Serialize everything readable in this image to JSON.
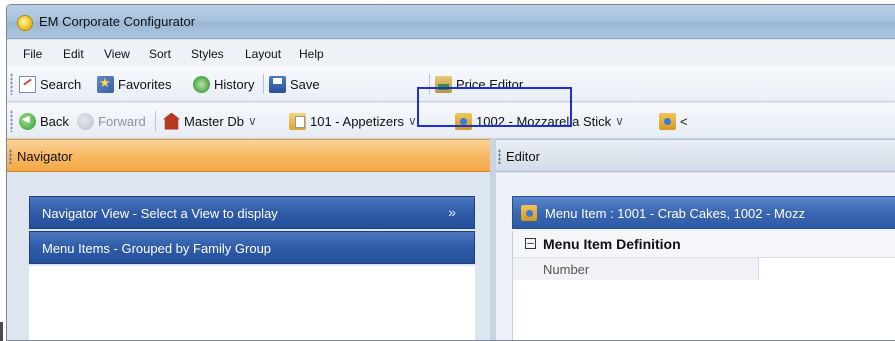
{
  "window": {
    "title": "EM Corporate Configurator"
  },
  "menu": [
    "File",
    "Edit",
    "View",
    "Sort",
    "Styles",
    "Layout",
    "Help"
  ],
  "toolbar": {
    "search": "Search",
    "favorites": "Favorites",
    "history": "History",
    "save": "Save",
    "price_editor": "Price Editor"
  },
  "navbar": {
    "back": "Back",
    "forward": "Forward",
    "crumbs": [
      "Master Db",
      "101 - Appetizers",
      "1002 - Mozzarella Stick"
    ],
    "more": "<"
  },
  "navigator": {
    "title": "Navigator",
    "view_selector": "Navigator View - Select a View to display",
    "view_selector_icon": "double-chevron-down-icon",
    "current_view": "Menu Items - Grouped by Family Group"
  },
  "editor": {
    "title": "Editor",
    "record_title": "Menu Item : 1001 - Crab Cakes, 1002 - Mozz",
    "section": {
      "toggle": "⊟",
      "label": "Menu Item Definition"
    },
    "rows": [
      {
        "label": "Number"
      }
    ]
  },
  "colors": {
    "highlight_box": "#1f2fd6",
    "navigator_header": "#f7b964",
    "nav_bar": "#2f5ba8"
  }
}
